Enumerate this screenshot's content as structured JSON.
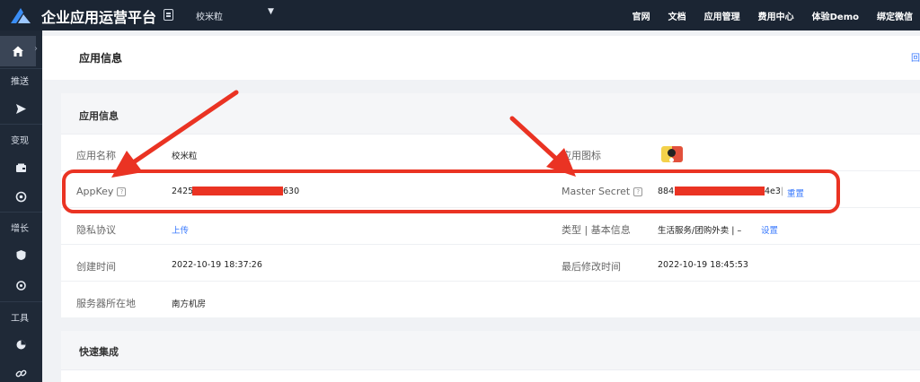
{
  "header": {
    "brand": "企业应用运营平台",
    "app_name": "校米粒",
    "nav": [
      "官网",
      "文档",
      "应用管理",
      "费用中心",
      "体验Demo",
      "绑定微信"
    ]
  },
  "sidebar": {
    "sections": [
      "推送",
      "变现",
      "增长",
      "工具"
    ]
  },
  "page": {
    "title": "应用信息",
    "right_text": "回"
  },
  "card": {
    "title": "应用信息",
    "rows": {
      "app_name_label": "应用名称",
      "app_name_value": "校米粒",
      "app_icon_label": "应用图标",
      "appkey_label": "AppKey",
      "appkey_prefix": "2425",
      "appkey_suffix": "630",
      "master_label": "Master Secret",
      "master_prefix": "884",
      "master_suffix": "4e3",
      "reset_label": "重置",
      "privacy_label": "隐私协议",
      "privacy_value": "上传",
      "type_label": "类型 | 基本信息",
      "type_value": "生活服务/团购外卖 | –",
      "type_setting": "设置",
      "created_label": "创建时间",
      "created_value": "2022-10-19 18:37:26",
      "modified_label": "最后修改时间",
      "modified_value": "2022-10-19 18:45:53",
      "server_label": "服务器所在地",
      "server_value": "南方机房"
    }
  },
  "card2": {
    "title": "快速集成"
  },
  "colors": {
    "topbar": "#1b2533",
    "sidebar": "#1f2937",
    "link": "#3a7afe",
    "annotation_red": "#ea3323"
  }
}
